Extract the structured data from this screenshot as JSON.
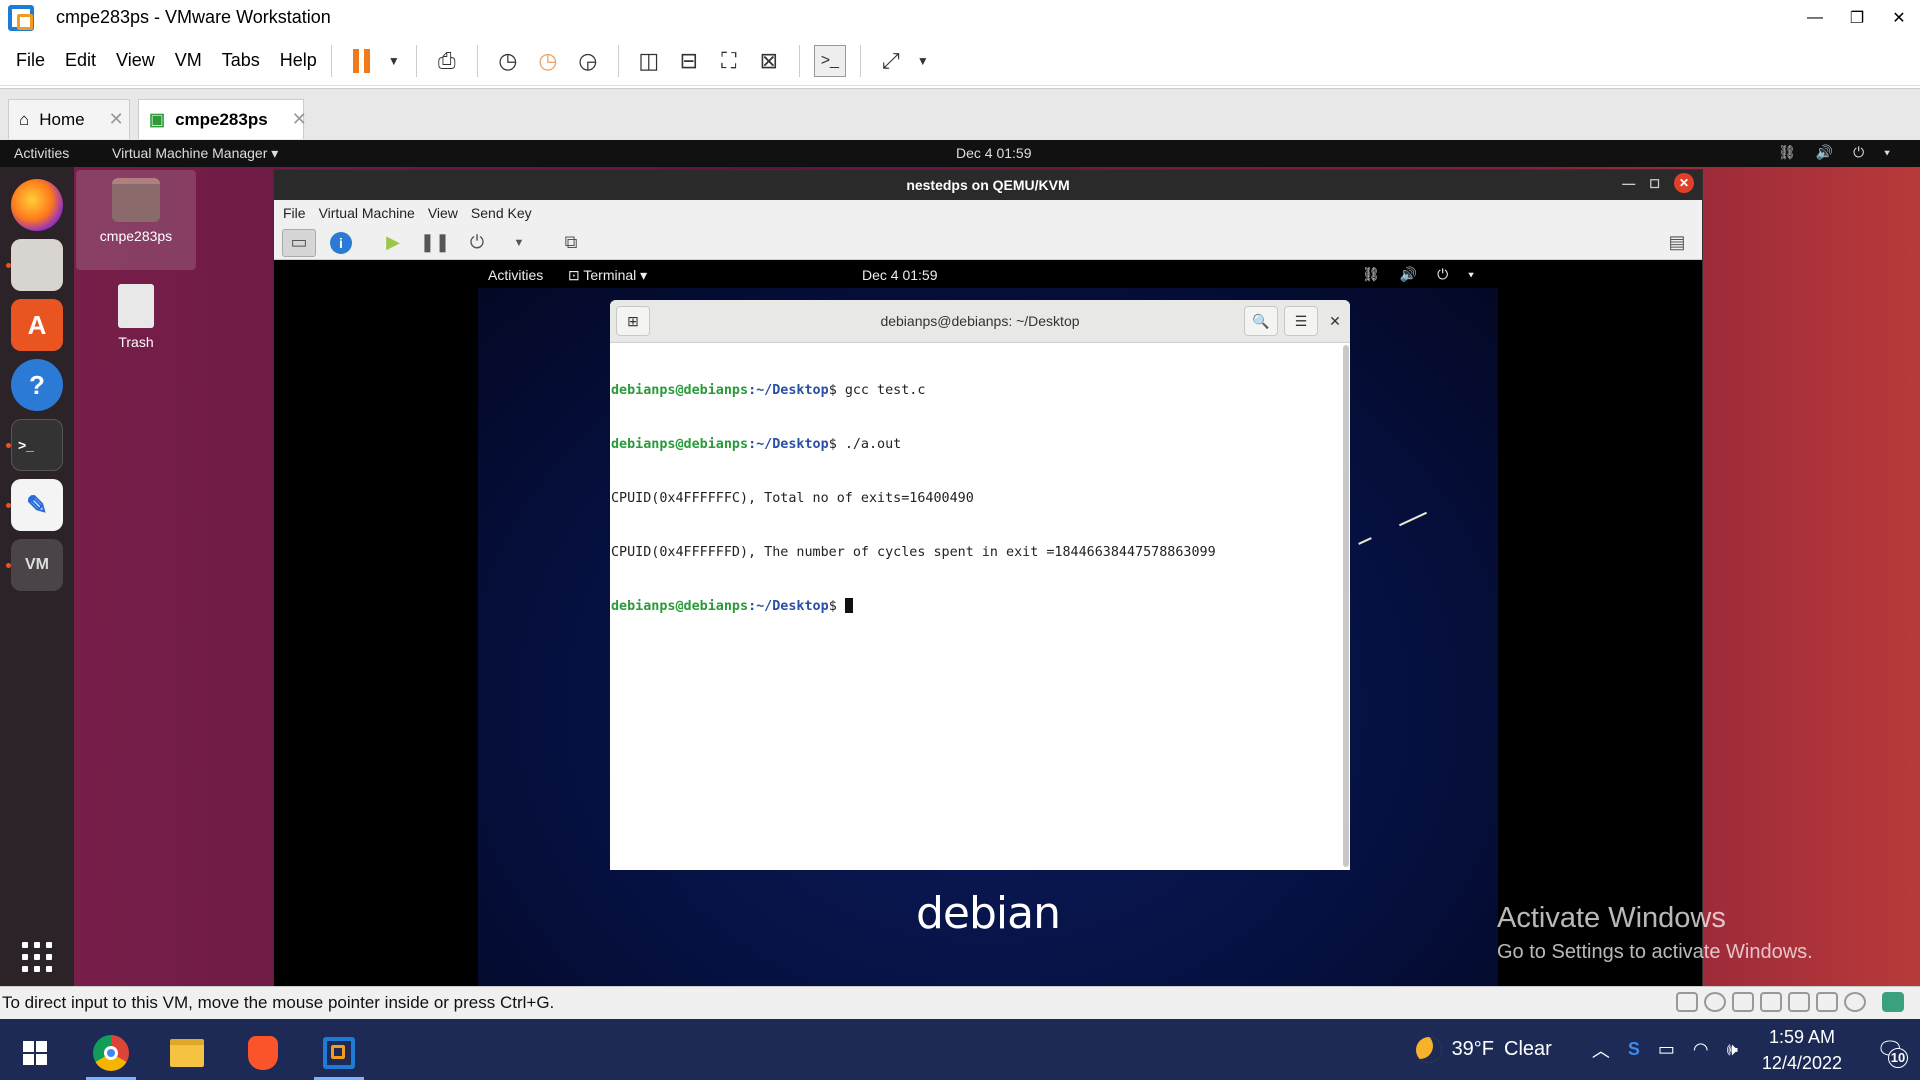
{
  "window": {
    "title": "cmpe283ps - VMware Workstation",
    "controls": {
      "minimize": "—",
      "restore": "❐",
      "close": "✕"
    }
  },
  "menubar": [
    "File",
    "Edit",
    "View",
    "VM",
    "Tabs",
    "Help"
  ],
  "tabs": [
    {
      "label": "Home",
      "icon": "home-icon"
    },
    {
      "label": "cmpe283ps",
      "icon": "vm-tab-icon",
      "active": true
    }
  ],
  "ubuntu": {
    "activities": "Activities",
    "app_menu": "Virtual Machine Manager ▾",
    "clock": "Dec 4  01:59",
    "system_icons": "⛓ 🔊 ⏻ ▾",
    "desktop_icons": [
      {
        "label": "cmpe283ps",
        "icon": "home-folder-icon"
      },
      {
        "label": "Trash",
        "icon": "trash-icon"
      }
    ],
    "dock": [
      "firefox-icon",
      "files-icon",
      "software-icon",
      "help-icon",
      "terminal-icon",
      "text-editor-icon",
      "virt-manager-icon",
      "show-apps-icon"
    ]
  },
  "virt_manager": {
    "title": "nestedps on QEMU/KVM",
    "menu": [
      "File",
      "Virtual Machine",
      "View",
      "Send Key"
    ]
  },
  "debian": {
    "activities": "Activities",
    "app_menu": "Terminal ▾",
    "clock": "Dec 4  01:59",
    "system_icons": "⛓ 🔊 ⏻ ▾",
    "logo_text": "debian"
  },
  "terminal": {
    "title": "debianps@debianps: ~/Desktop",
    "prompt_user": "debianps@debianps",
    "prompt_path": ":~/Desktop",
    "lines": [
      {
        "type": "cmd",
        "text": "gcc test.c"
      },
      {
        "type": "cmd",
        "text": "./a.out"
      },
      {
        "type": "out",
        "text": "CPUID(0x4FFFFFFC), Total no of exits=16400490"
      },
      {
        "type": "out",
        "text": "CPUID(0x4FFFFFFD), The number of cycles spent in exit =18446638447578863099"
      },
      {
        "type": "prompt",
        "text": ""
      }
    ]
  },
  "watermark": {
    "line1": "Activate Windows",
    "line2": "Go to Settings to activate Windows."
  },
  "status_bar": {
    "text": "To direct input to this VM, move the mouse pointer inside or press Ctrl+G."
  },
  "taskbar": {
    "apps": [
      "windows-start-icon",
      "chrome-icon",
      "file-explorer-icon",
      "brave-icon",
      "vmware-icon"
    ],
    "weather": {
      "temp": "39°F",
      "condition": "Clear"
    },
    "time": "1:59 AM",
    "date": "12/4/2022",
    "notifications": "10"
  }
}
